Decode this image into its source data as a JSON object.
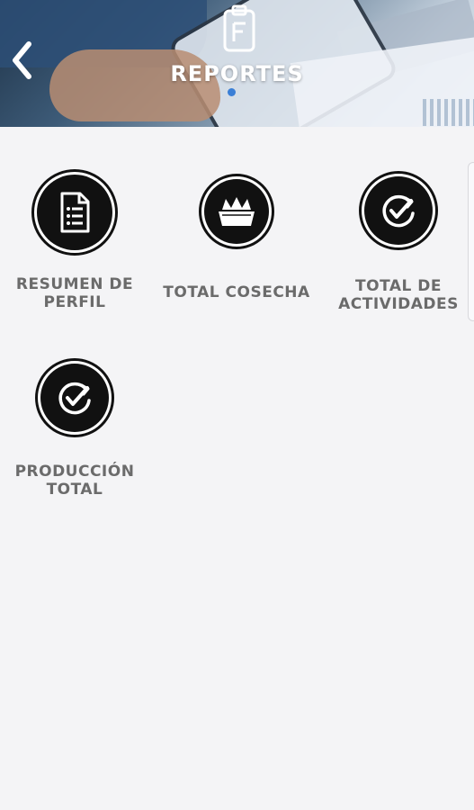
{
  "header": {
    "title": "REPORTES",
    "back_icon": "chevron-left-icon",
    "icon": "clipboard-report-icon"
  },
  "tiles": [
    {
      "label": "RESUMEN DE\nPERFIL",
      "icon": "document-list-icon"
    },
    {
      "label": "TOTAL COSECHA",
      "icon": "harvest-basket-icon"
    },
    {
      "label": "TOTAL DE\nACTIVIDADES",
      "icon": "refresh-check-icon"
    },
    {
      "label": "PRODUCCIÓN\nTOTAL",
      "icon": "refresh-check-icon"
    }
  ],
  "colors": {
    "background": "#f4f4f6",
    "label": "#6b6b6b",
    "icon": "#111111",
    "header_text": "#ffffff",
    "indicator_dot": "#3a7fd6"
  }
}
